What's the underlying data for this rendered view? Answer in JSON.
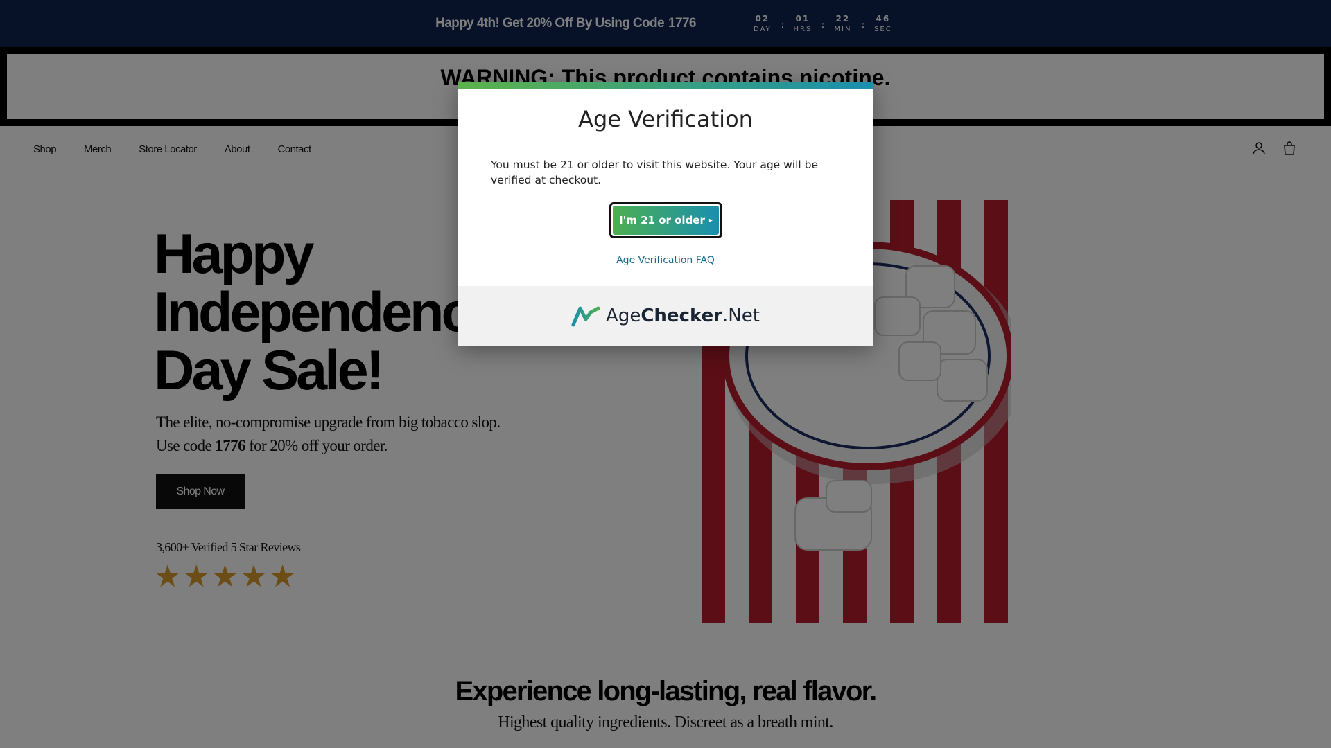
{
  "announcement": {
    "text": "Happy 4th! Get 20% Off By Using Code",
    "code": "1776",
    "countdown": [
      {
        "value": "02",
        "label": "DAY"
      },
      {
        "value": "01",
        "label": "HRS"
      },
      {
        "value": "22",
        "label": "MIN"
      },
      {
        "value": "46",
        "label": "SEC"
      }
    ]
  },
  "warning": {
    "text": "WARNING: This product contains nicotine."
  },
  "nav": {
    "items": [
      "Shop",
      "Merch",
      "Store Locator",
      "About",
      "Contact"
    ],
    "icons": [
      "account-icon",
      "cart-icon"
    ]
  },
  "hero": {
    "title_lines": [
      "Happy",
      "Independence",
      "Day Sale!"
    ],
    "subtitle_line1": "The elite, no-compromise upgrade from big tobacco slop.",
    "subtitle_line2_pre": "Use code",
    "subtitle_line2_code": "1776",
    "subtitle_line2_post": "for 20% off your order.",
    "button_label": "Shop Now",
    "reviews_text": "3,600+ Verified 5 Star Reviews",
    "rating": 5,
    "star_glyph": "★"
  },
  "section2": {
    "title": "Experience long-lasting, real flavor.",
    "subtitle": "Highest quality ingredients. Discreet as a breath mint."
  },
  "modal": {
    "title": "Age Verification",
    "text": "You must be 21 or older to visit this website. Your age will be verified at checkout.",
    "button_label": "I'm 21 or older",
    "button_arrow": "▸",
    "faq_link": "Age Verification FAQ",
    "brand_part1": "Age",
    "brand_part2": "Checker",
    "brand_part3": ".Net"
  },
  "colors": {
    "announcement_bg": "#0e2552",
    "star": "#d89a2b",
    "gradient_start": "#4caf50",
    "gradient_end": "#1a8fae",
    "flag_red": "#b71c2c"
  }
}
